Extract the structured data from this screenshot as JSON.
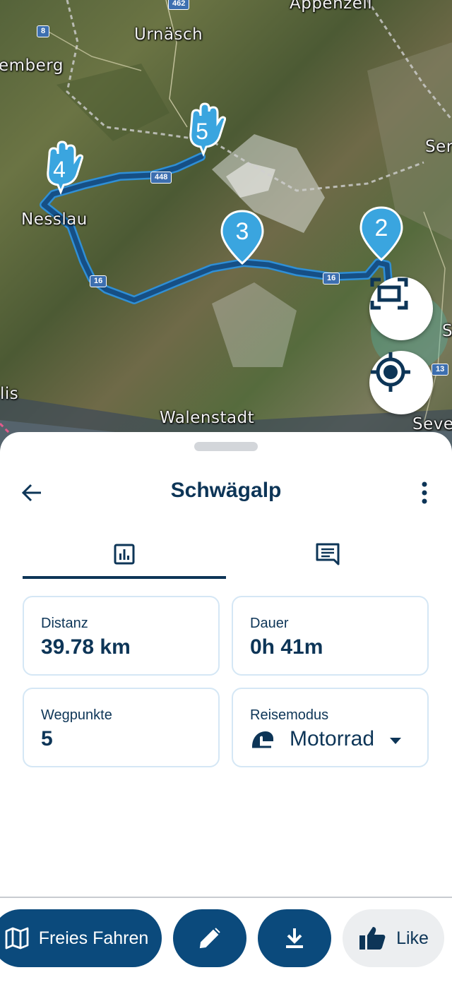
{
  "map": {
    "places": [
      "Appenzell",
      "Urnäsch",
      "emberg",
      "Nesslau",
      "Walenstadt",
      "Ser",
      "lis",
      "Seve",
      "S"
    ],
    "road_shields": [
      "462",
      "8",
      "448",
      "16",
      "16",
      "13"
    ],
    "waypoints": [
      {
        "number": "2",
        "style": "pin"
      },
      {
        "number": "3",
        "style": "pin"
      },
      {
        "number": "4",
        "style": "hand"
      },
      {
        "number": "5",
        "style": "hand"
      }
    ],
    "buttons": {
      "fit_route": "fit-route",
      "locate": "my-location"
    }
  },
  "sheet": {
    "title": "Schwägalp",
    "tabs": [
      {
        "name": "stats",
        "icon": "bar-chart-icon",
        "selected": true
      },
      {
        "name": "comments",
        "icon": "comment-icon",
        "selected": false
      }
    ],
    "stats": {
      "distance": {
        "label": "Distanz",
        "value": "39.78 km"
      },
      "duration": {
        "label": "Dauer",
        "value": "0h 41m"
      },
      "waypoints": {
        "label": "Wegpunkte",
        "value": "5"
      },
      "travel_mode": {
        "label": "Reisemodus",
        "value": "Motorrad",
        "icon": "helmet-icon"
      }
    }
  },
  "actions": {
    "free_ride": "Freies Fahren",
    "like": "Like"
  },
  "colors": {
    "primary": "#0b4a7c",
    "text": "#0d3557",
    "route": "#1f5f99",
    "route_outline": "#2f8fd6",
    "pin": "#3aa5df",
    "card_border": "#d5e7f5"
  }
}
